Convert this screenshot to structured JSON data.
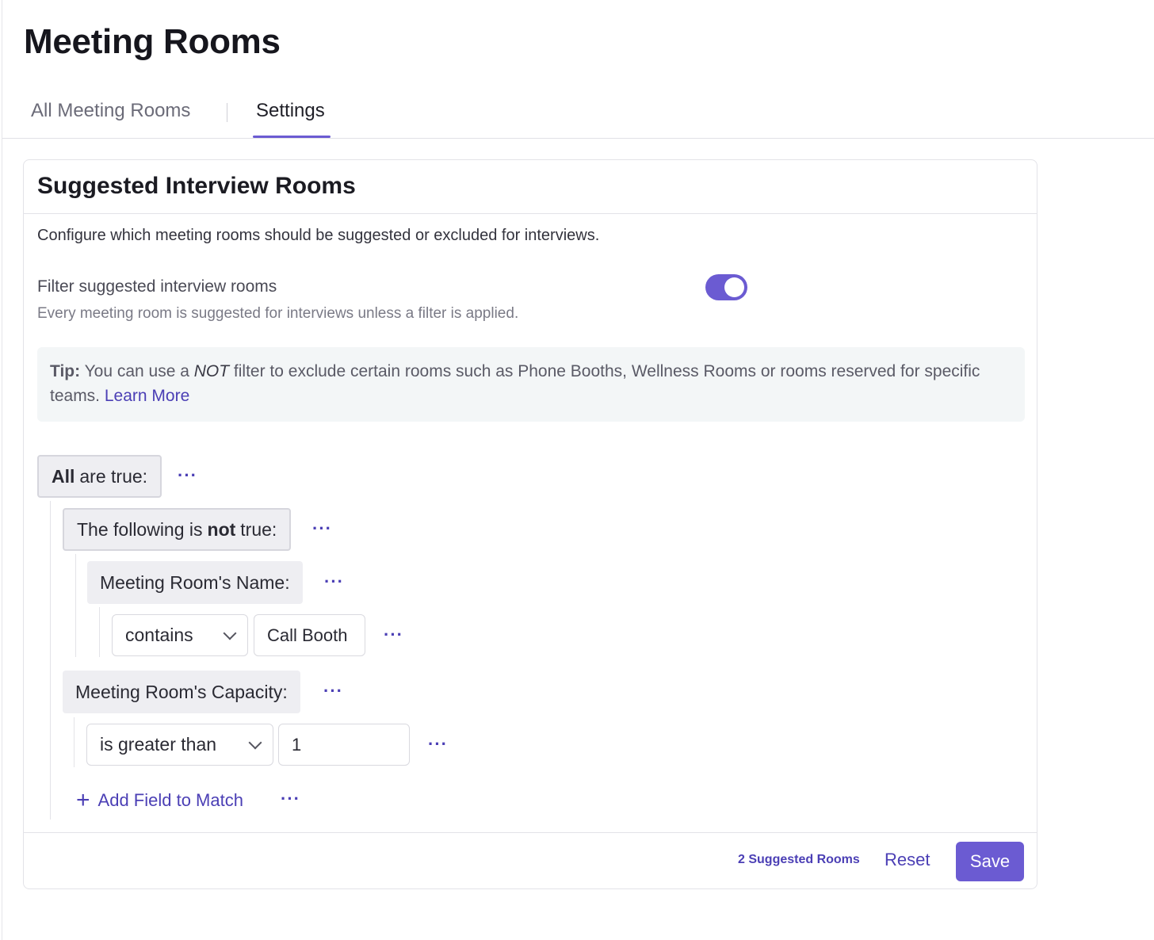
{
  "page": {
    "title": "Meeting Rooms"
  },
  "tabs": [
    {
      "label": "All Meeting Rooms",
      "active": false
    },
    {
      "label": "Settings",
      "active": true
    }
  ],
  "card": {
    "title": "Suggested Interview Rooms",
    "description": "Configure which meeting rooms should be suggested or excluded for interviews.",
    "filter": {
      "label": "Filter suggested interview rooms",
      "help": "Every meeting room is suggested for interviews unless a filter is applied.",
      "enabled": true
    },
    "tip": {
      "prefix": "Tip:",
      "text_before": " You can use a ",
      "emphasis": "NOT",
      "text_after": " filter to exclude certain rooms such as Phone Booths, Wellness Rooms or rooms reserved for specific teams. ",
      "link": "Learn More"
    }
  },
  "rules": {
    "root": {
      "bold": "All",
      "rest": "are true:"
    },
    "not_group": {
      "text": "The following is",
      "bold": "not",
      "tail": "true:"
    },
    "name_field": {
      "label": "Meeting Room's Name:",
      "operator": "contains",
      "value": "Call Booth"
    },
    "capacity_field": {
      "label": "Meeting Room's Capacity:",
      "operator": "is greater than",
      "value": "1"
    },
    "add_field_label": "Add Field to Match",
    "more_glyph": "···"
  },
  "footer": {
    "suggested_count": "2 Suggested Rooms",
    "reset_label": "Reset",
    "save_label": "Save"
  },
  "colors": {
    "accent": "#6b5bd2",
    "link": "#4b3fb5"
  }
}
